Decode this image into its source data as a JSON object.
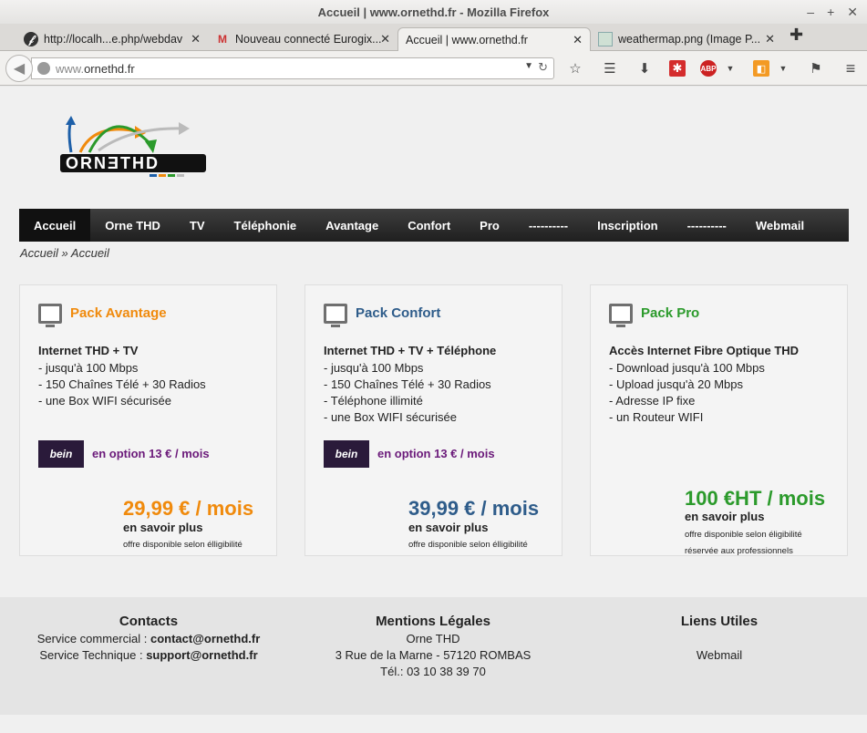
{
  "window": {
    "title": "Accueil | www.ornethd.fr - Mozilla Firefox"
  },
  "tabs": [
    {
      "label": "http://localh...e.php/webdav",
      "icon": "wordpress-icon"
    },
    {
      "label": "Nouveau connecté Eurogix...",
      "icon": "gmail-icon"
    },
    {
      "label": "Accueil | www.ornethd.fr",
      "icon": "none",
      "active": true
    },
    {
      "label": "weathermap.png (Image P...",
      "icon": "image-icon"
    }
  ],
  "urlbar": {
    "prefix": "www.",
    "domain": "ornethd.fr"
  },
  "colors": {
    "orange": "#f08a0c",
    "blue": "#2e5c8a",
    "green": "#2b9a2b",
    "purple": "#6b1a7a",
    "menu": "#2b2b2b"
  },
  "menu": [
    "Accueil",
    "Orne THD",
    "TV",
    "Téléphonie",
    "Avantage",
    "Confort",
    "Pro",
    "----------",
    "Inscription",
    "----------",
    "Webmail"
  ],
  "breadcrumb": {
    "first": "Accueil",
    "sep": "»",
    "second": "Accueil"
  },
  "cards": [
    {
      "title": "Pack Avantage",
      "headline": "Internet THD + TV",
      "items": [
        "- jusqu'à 100 Mbps",
        "- 150 Chaînes Télé + 30 Radios",
        "- une Box WIFI sécurisée"
      ],
      "bein": "bein",
      "option": "en option 13 € / mois",
      "price": "29,99 € / mois",
      "more": "en savoir plus",
      "note": "offre disponible selon élligibilité"
    },
    {
      "title": "Pack Confort",
      "headline": "Internet THD + TV + Téléphone",
      "items": [
        "- jusqu'à 100 Mbps",
        "- 150 Chaînes Télé + 30 Radios",
        "- Téléphone illimité",
        "- une Box WIFI sécurisée"
      ],
      "bein": "bein",
      "option": "en option 13 € / mois",
      "price": "39,99 € / mois",
      "more": "en savoir plus",
      "note": "offre disponible selon élligibilité"
    },
    {
      "title": "Pack Pro",
      "headline": "Accès Internet Fibre Optique THD",
      "items": [
        "- Download jusqu'à 100 Mbps",
        "- Upload jusqu'à 20 Mbps",
        "- Adresse IP fixe",
        "- un Routeur WIFI"
      ],
      "price": "100 €HT / mois",
      "more": "en savoir plus",
      "note": "offre disponible selon éligibilité",
      "note2": "réservée aux professionnels"
    }
  ],
  "footer": {
    "contacts": {
      "title": "Contacts",
      "line1_label": "Service commercial : ",
      "line1_email": "contact@ornethd.fr",
      "line2_label": "Service Technique : ",
      "line2_email": "support@ornethd.fr"
    },
    "legal": {
      "title": "Mentions Légales",
      "name": "Orne THD",
      "address": "3 Rue de la Marne - 57120 ROMBAS",
      "tel": "Tél.: 03 10 38 39 70"
    },
    "links": {
      "title": "Liens Utiles",
      "webmail": "Webmail"
    }
  }
}
